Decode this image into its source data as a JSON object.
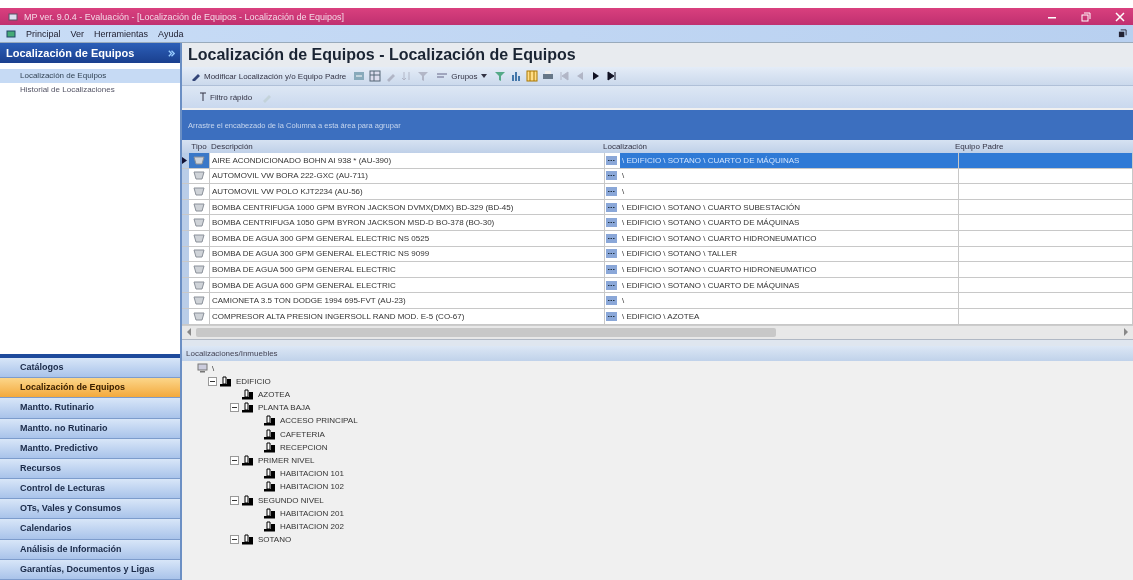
{
  "window": {
    "title": "MP ver. 9.0.4 - Evaluación - [Localización de Equipos - Localización de Equipos]"
  },
  "menu": [
    "Principal",
    "Ver",
    "Herramientas",
    "Ayuda"
  ],
  "sidebar": {
    "title": "Localización de Equipos",
    "items": [
      {
        "label": "Localización de Equipos",
        "selected": true
      },
      {
        "label": "Historial de Localizaciones",
        "selected": false
      }
    ],
    "nav": [
      {
        "label": "Catálogos",
        "selected": false
      },
      {
        "label": "Localización de Equipos",
        "selected": true
      },
      {
        "label": "Mantto. Rutinario",
        "selected": false
      },
      {
        "label": "Mantto. no Rutinario",
        "selected": false
      },
      {
        "label": "Mantto. Predictivo",
        "selected": false
      },
      {
        "label": "Recursos",
        "selected": false
      },
      {
        "label": "Control de Lecturas",
        "selected": false
      },
      {
        "label": "OTs, Vales y Consumos",
        "selected": false
      },
      {
        "label": "Calendarios",
        "selected": false
      },
      {
        "label": "Análisis de Información",
        "selected": false
      },
      {
        "label": "Garantías, Documentos y Ligas",
        "selected": false
      }
    ]
  },
  "page_title": "Localización de Equipos - Localización de Equipos",
  "toolbar": {
    "modify": "Modificar Localización y/o Equipo Padre",
    "groups": "Grupos",
    "filter": "Filtro rápido"
  },
  "group_hint": "Arrastre el encabezado de la Columna a esta área para agrupar",
  "table": {
    "columns": [
      "Tipo",
      "Descripción",
      "Localización",
      "Equipo Padre"
    ],
    "rows": [
      {
        "description": "AIRE ACONDICIONADO BOHN AI 938 * (AU-390)",
        "location": "\\ EDIFICIO \\ SOTANO \\ CUARTO DE MÁQUINAS",
        "selected": true
      },
      {
        "description": "AUTOMOVIL VW BORA 222-GXC (AU-711)",
        "location": "\\",
        "selected": false
      },
      {
        "description": "AUTOMOVIL VW POLO KJT2234 (AU-56)",
        "location": "\\",
        "selected": false
      },
      {
        "description": "BOMBA CENTRIFUGA 1000 GPM BYRON JACKSON DVMX(DMX) BD-329 (BD-45)",
        "location": "\\ EDIFICIO \\ SOTANO \\ CUARTO SUBESTACIÓN",
        "selected": false
      },
      {
        "description": "BOMBA CENTRIFUGA 1050 GPM BYRON JACKSON MSD-D BO-378 (BO-30)",
        "location": "\\ EDIFICIO \\ SOTANO \\ CUARTO DE MÁQUINAS",
        "selected": false
      },
      {
        "description": "BOMBA DE AGUA 300 GPM GENERAL ELECTRIC NS 0525",
        "location": "\\ EDIFICIO \\ SOTANO \\ CUARTO HIDRONEUMATICO",
        "selected": false
      },
      {
        "description": "BOMBA DE AGUA 300 GPM GENERAL ELECTRIC NS 9099",
        "location": "\\ EDIFICIO \\ SOTANO \\ TALLER",
        "selected": false
      },
      {
        "description": "BOMBA DE AGUA 500 GPM GENERAL ELECTRIC",
        "location": "\\ EDIFICIO \\ SOTANO \\ CUARTO HIDRONEUMATICO",
        "selected": false
      },
      {
        "description": "BOMBA DE AGUA 600 GPM GENERAL ELECTRIC",
        "location": "\\ EDIFICIO \\ SOTANO \\ CUARTO DE MÁQUINAS",
        "selected": false
      },
      {
        "description": "CAMIONETA 3.5 TON DODGE 1994 695-FVT (AU-23)",
        "location": "\\",
        "selected": false
      },
      {
        "description": "COMPRESOR ALTA PRESION INGERSOLL RAND MOD. E-5 (CO-67)",
        "location": "\\ EDIFICIO \\ AZOTEA",
        "selected": false
      }
    ]
  },
  "tree": {
    "title": "Localizaciones/Inmuebles",
    "nodes": [
      {
        "label": "\\",
        "children": [
          {
            "label": "EDIFICIO",
            "expanded": true,
            "children": [
              {
                "label": "AZOTEA",
                "expanded": false
              },
              {
                "label": "PLANTA BAJA",
                "expanded": true,
                "children": [
                  {
                    "label": "ACCESO PRINCIPAL",
                    "expanded": false
                  },
                  {
                    "label": "CAFETERIA",
                    "expanded": false
                  },
                  {
                    "label": "RECEPCION",
                    "expanded": false
                  }
                ]
              },
              {
                "label": "PRIMER NIVEL",
                "expanded": true,
                "children": [
                  {
                    "label": "HABITACION 101",
                    "expanded": false
                  },
                  {
                    "label": "HABITACION 102",
                    "expanded": false
                  }
                ]
              },
              {
                "label": "SEGUNDO NIVEL",
                "expanded": true,
                "children": [
                  {
                    "label": "HABITACION 201",
                    "expanded": false
                  },
                  {
                    "label": "HABITACION 202",
                    "expanded": false
                  }
                ]
              },
              {
                "label": "SOTANO",
                "expanded": true
              }
            ]
          }
        ]
      }
    ]
  }
}
